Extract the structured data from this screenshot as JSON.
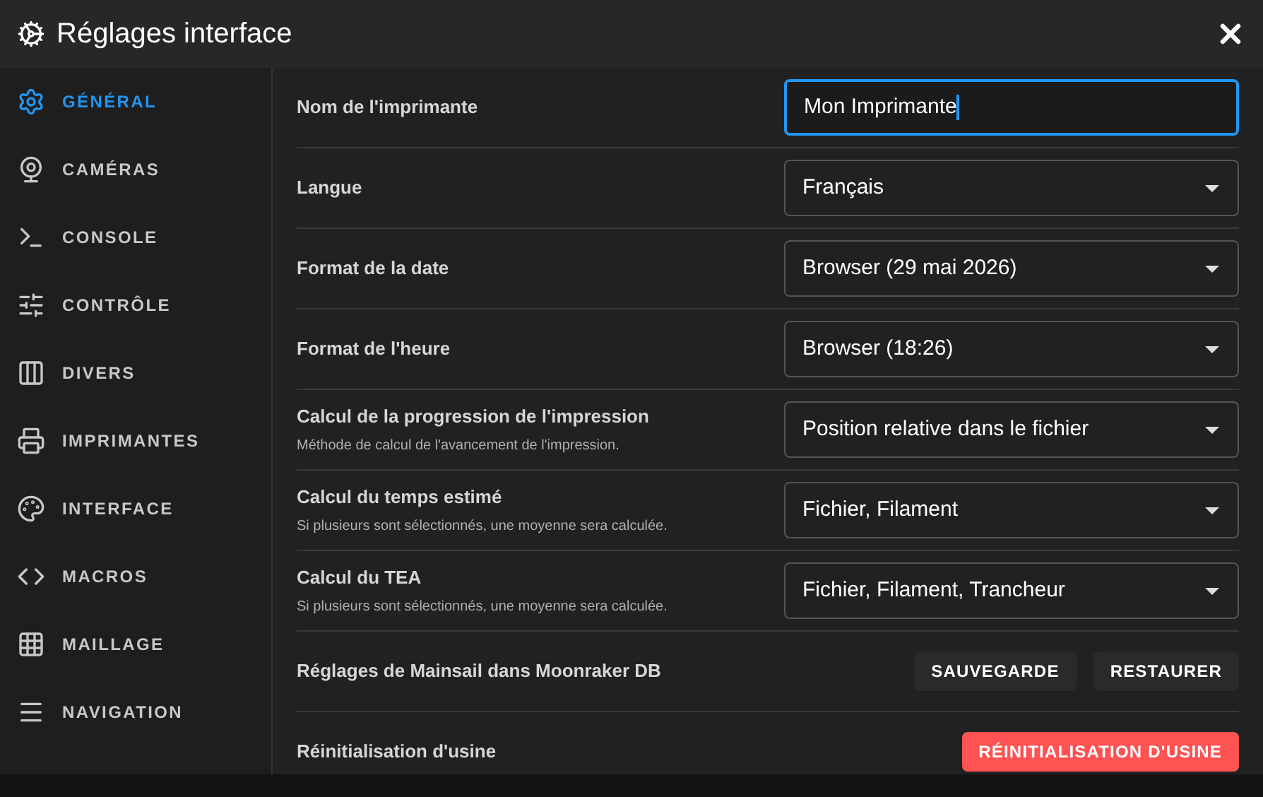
{
  "window": {
    "title": "Réglages interface"
  },
  "sidebar": {
    "items": [
      {
        "label": "GÉNÉRAL",
        "selected": true
      },
      {
        "label": "CAMÉRAS",
        "selected": false
      },
      {
        "label": "CONSOLE",
        "selected": false
      },
      {
        "label": "CONTRÔLE",
        "selected": false
      },
      {
        "label": "DIVERS",
        "selected": false
      },
      {
        "label": "IMPRIMANTES",
        "selected": false
      },
      {
        "label": "INTERFACE",
        "selected": false
      },
      {
        "label": "MACROS",
        "selected": false
      },
      {
        "label": "MAILLAGE",
        "selected": false
      },
      {
        "label": "NAVIGATION",
        "selected": false
      }
    ]
  },
  "settings": [
    {
      "kind": "text",
      "label": "Nom de l'imprimante",
      "value": "Mon Imprimante",
      "focused": true
    },
    {
      "kind": "select",
      "label": "Langue",
      "value": "Français"
    },
    {
      "kind": "select",
      "label": "Format de la date",
      "value": "Browser (29 mai 2026)"
    },
    {
      "kind": "select",
      "label": "Format de l'heure",
      "value": "Browser (18:26)"
    },
    {
      "kind": "select",
      "label": "Calcul de la progression de l'impression",
      "description": "Méthode de calcul de l'avancement de l'impression.",
      "value": "Position relative dans le fichier"
    },
    {
      "kind": "select",
      "label": "Calcul du temps estimé",
      "description": "Si plusieurs sont sélectionnés, une moyenne sera calculée.",
      "value": "Fichier, Filament"
    },
    {
      "kind": "select",
      "label": "Calcul du TEA",
      "description": "Si plusieurs sont sélectionnés, une moyenne sera calculée.",
      "value": "Fichier, Filament, Trancheur"
    },
    {
      "kind": "buttons",
      "label": "Réglages de Mainsail dans Moonraker DB",
      "buttons": [
        {
          "label": "SAUVEGARDE",
          "danger": false
        },
        {
          "label": "RESTAURER",
          "danger": false
        }
      ]
    },
    {
      "kind": "buttons",
      "label": "Réinitialisation d'usine",
      "buttons": [
        {
          "label": "RÉINITIALISATION D'USINE",
          "danger": true
        }
      ]
    }
  ]
}
